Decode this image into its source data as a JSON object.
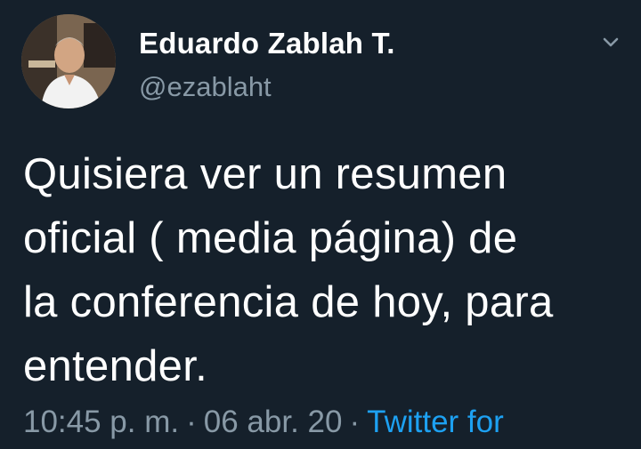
{
  "tweet": {
    "author_name": "Eduardo Zablah T.",
    "author_handle": "@ezablaht",
    "text_lines": [
      "Quisiera ver un resumen",
      "oficial ( media página) de",
      "la conferencia de hoy, para",
      "entender."
    ],
    "time": "10:45 p. m.",
    "date": "06 abr. 20",
    "separator": "·",
    "source": "Twitter for"
  },
  "icons": {
    "menu": "chevron-down-icon",
    "avatar": "profile-photo"
  },
  "colors": {
    "background": "#15202b",
    "primary_text": "#ffffff",
    "secondary_text": "#8899a6",
    "link": "#1da1f2"
  }
}
